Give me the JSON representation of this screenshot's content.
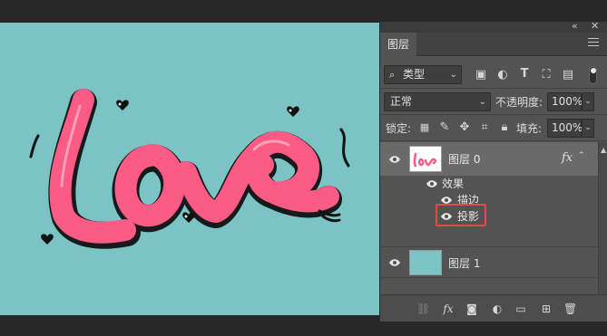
{
  "canvas": {
    "background": "#7bc3c4",
    "artwork_text": "Love",
    "artwork_color": "#fb5b84"
  },
  "panel": {
    "tab_label": "图层",
    "filter_label": "类型",
    "blend_mode": "正常",
    "opacity_label": "不透明度:",
    "opacity_value": "100%",
    "lock_label": "锁定:",
    "fill_label": "填充:",
    "fill_value": "100%",
    "icons": [
      "image-filter-icon",
      "adjust-filter-icon",
      "type-filter-icon",
      "shape-filter-icon",
      "smart-object-filter-icon"
    ]
  },
  "layers": [
    {
      "name": "图层 0",
      "has_fx": true,
      "fx_label": "fx",
      "effects_label": "效果",
      "effects": [
        "描边",
        "投影"
      ]
    },
    {
      "name": "图层 1",
      "thumb_color": "#7bc3c4"
    }
  ],
  "accent": "#e8454d"
}
